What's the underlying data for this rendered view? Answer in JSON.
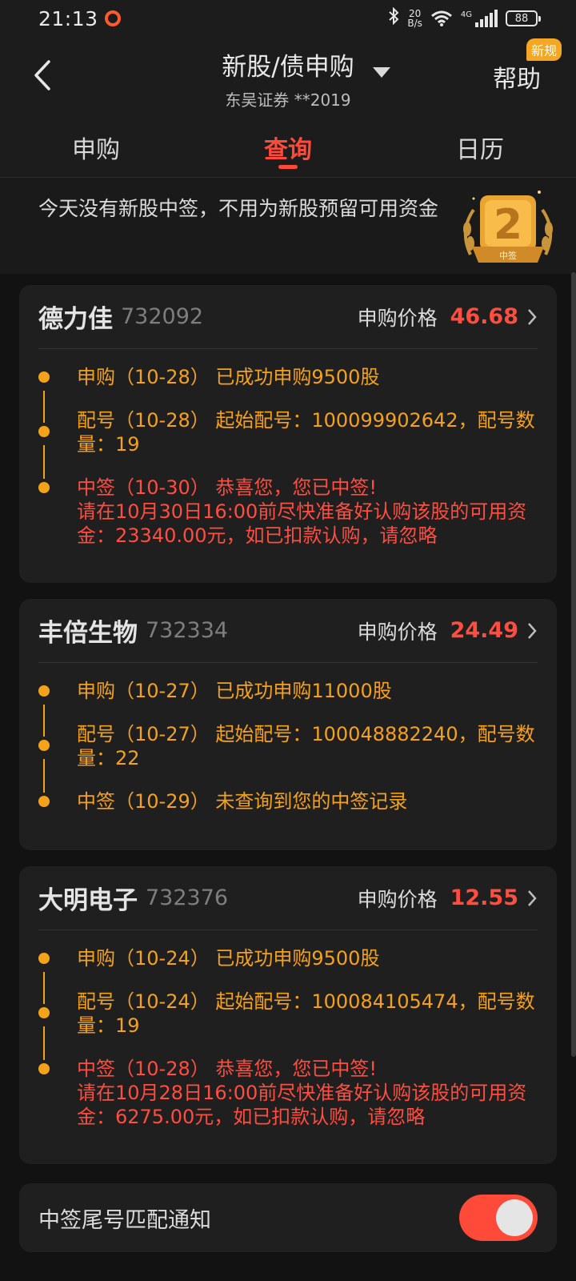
{
  "status_bar": {
    "time": "21:13",
    "net_speed_top": "20",
    "net_speed_bottom": "B/s",
    "network_type": "4G",
    "battery": "88"
  },
  "header": {
    "title": "新股/债申购",
    "subtitle": "东吴证券 **2019",
    "help_label": "帮助",
    "new_badge": "新规"
  },
  "tabs": [
    {
      "label": "申购",
      "active": false
    },
    {
      "label": "查询",
      "active": true
    },
    {
      "label": "日历",
      "active": false
    }
  ],
  "notice": {
    "text": "今天没有新股中签，不用为新股预留可用资金",
    "trophy_label": "中签",
    "trophy_number": "2"
  },
  "cards": [
    {
      "name": "德力佳",
      "code": "732092",
      "price_label": "申购价格",
      "price": "46.68",
      "events": [
        {
          "text": "申购（10-28） 已成功申购9500股",
          "color": "orange"
        },
        {
          "text": "配号（10-28） 起始配号：100099902642，配号数量：19",
          "color": "orange"
        },
        {
          "text": "中签（10-30） 恭喜您，您已中签!",
          "detail": "请在10月30日16:00前尽快准备好认购该股的可用资金：23340.00元，如已扣款认购，请忽略",
          "color": "red"
        }
      ]
    },
    {
      "name": "丰倍生物",
      "code": "732334",
      "price_label": "申购价格",
      "price": "24.49",
      "events": [
        {
          "text": "申购（10-27） 已成功申购11000股",
          "color": "orange"
        },
        {
          "text": "配号（10-27） 起始配号：100048882240，配号数量：22",
          "color": "orange"
        },
        {
          "text": "中签（10-29） 未查询到您的中签记录",
          "color": "orange"
        }
      ]
    },
    {
      "name": "大明电子",
      "code": "732376",
      "price_label": "申购价格",
      "price": "12.55",
      "events": [
        {
          "text": "申购（10-24） 已成功申购9500股",
          "color": "orange"
        },
        {
          "text": "配号（10-24） 起始配号：100084105474，配号数量：19",
          "color": "orange"
        },
        {
          "text": "中签（10-28） 恭喜您，您已中签!",
          "detail": "请在10月28日16:00前尽快准备好认购该股的可用资金：6275.00元，如已扣款认购，请忽略",
          "color": "red"
        }
      ]
    }
  ],
  "bottom": {
    "label": "中签尾号匹配通知",
    "toggle_on": true
  },
  "colors": {
    "accent_red": "#ff4a3a",
    "orange": "#f5a21b",
    "background": "#121212"
  }
}
